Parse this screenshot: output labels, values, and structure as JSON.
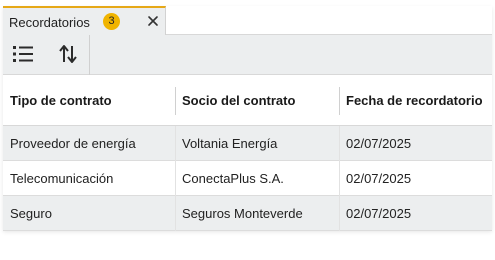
{
  "tab": {
    "label": "Recordatorios",
    "badge": "3",
    "close_icon": "close-icon",
    "accent": "#e6a817",
    "badge_color": "#f0b400"
  },
  "toolbar": {
    "list_icon": "list-icon",
    "sort_icon": "sort-icon"
  },
  "table": {
    "columns": [
      "Tipo de contrato",
      "Socio del contrato",
      "Fecha de recordatorio"
    ],
    "rows": [
      [
        "Proveedor de energía",
        "Voltania Energía",
        "02/07/2025"
      ],
      [
        "Telecomunicación",
        "ConectaPlus S.A.",
        "02/07/2025"
      ],
      [
        "Seguro",
        "Seguros Monteverde",
        "02/07/2025"
      ]
    ]
  }
}
